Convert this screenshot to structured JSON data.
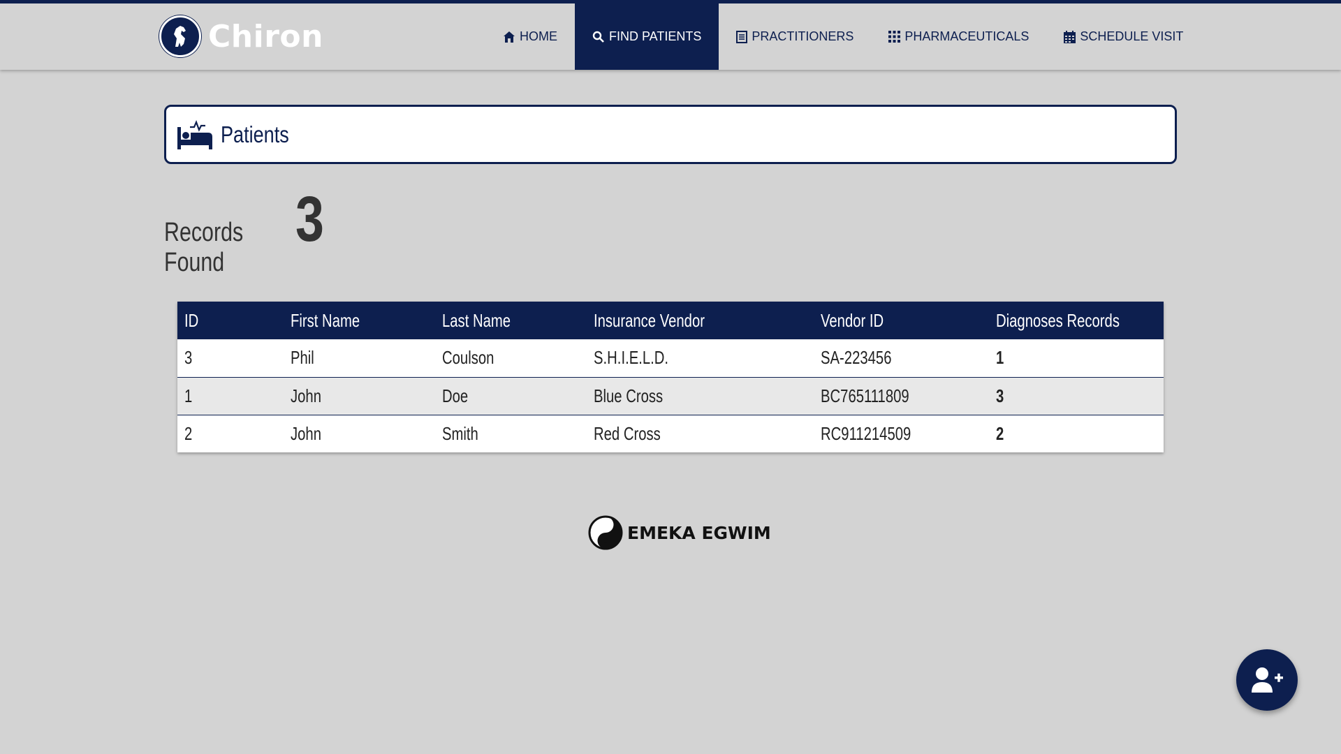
{
  "brand": {
    "name": "Chiron",
    "logo_icon": "horse-icon"
  },
  "nav": {
    "items": [
      {
        "label": "HOME",
        "icon": "home-icon",
        "active": false
      },
      {
        "label": "FIND PATIENTS",
        "icon": "search-icon",
        "active": true
      },
      {
        "label": "PRACTITIONERS",
        "icon": "list-icon",
        "active": false
      },
      {
        "label": "PHARMACEUTICALS",
        "icon": "grid-icon",
        "active": false
      },
      {
        "label": "SCHEDULE VISIT",
        "icon": "calendar-icon",
        "active": false
      }
    ]
  },
  "panel": {
    "title": "Patients",
    "icon": "patient-bed-icon"
  },
  "records": {
    "label": "Records Found",
    "count": "3"
  },
  "table": {
    "headers": [
      "ID",
      "First Name",
      "Last Name",
      "Insurance Vendor",
      "Vendor ID",
      "Diagnoses Records"
    ],
    "rows": [
      [
        "3",
        "Phil",
        "Coulson",
        "S.H.I.E.L.D.",
        "SA-223456",
        "1"
      ],
      [
        "1",
        "John",
        "Doe",
        "Blue Cross",
        "BC765111809",
        "3"
      ],
      [
        "2",
        "John",
        "Smith",
        "Red Cross",
        "RC911214509",
        "2"
      ]
    ]
  },
  "footer": {
    "text": "EMEKA EGWIM",
    "icon": "yin-yang-icon"
  },
  "fab": {
    "icon": "add-user-icon"
  },
  "colors": {
    "primary": "#0d1f4f",
    "background": "#d3d3d3"
  }
}
